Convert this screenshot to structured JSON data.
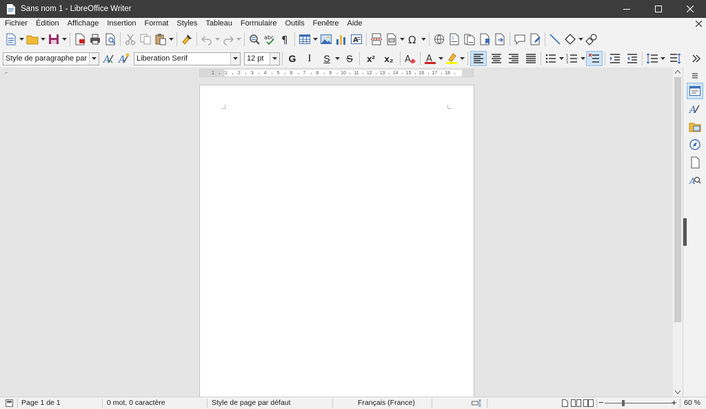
{
  "window": {
    "title": "Sans nom 1 - LibreOffice Writer"
  },
  "menu": [
    "Fichier",
    "Édition",
    "Affichage",
    "Insertion",
    "Format",
    "Styles",
    "Tableau",
    "Formulaire",
    "Outils",
    "Fenêtre",
    "Aide"
  ],
  "formatting": {
    "paragraph_style": "Style de paragraphe par défa",
    "font_name": "Liberation Serif",
    "font_size": "12 pt",
    "bold_label": "G",
    "italic_label": "I",
    "underline_label": "S",
    "strike_label": "S",
    "superscript_label": "x²",
    "subscript_label": "x₂"
  },
  "ruler": {
    "labels": [
      "1",
      "1",
      "2",
      "3",
      "4",
      "5",
      "6",
      "7",
      "8",
      "9",
      "10",
      "11",
      "12",
      "13",
      "14",
      "15",
      "16",
      "17",
      "18"
    ]
  },
  "statusbar": {
    "page": "Page 1 de 1",
    "words": "0 mot, 0 caractère",
    "page_style": "Style de page par défaut",
    "language": "Français (France)",
    "zoom": "60 %"
  },
  "colors": {
    "titlebar": "#3c3c3c",
    "chrome": "#f2f2f2",
    "workspace": "#e5e5e5",
    "font_color": "#c9211e",
    "highlight_color": "#ffff00",
    "active_button": "#cde3f6"
  }
}
